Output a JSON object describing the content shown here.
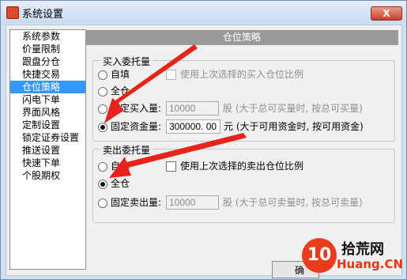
{
  "window": {
    "title": "系统设置",
    "close_label": "X"
  },
  "sidebar": {
    "items": [
      {
        "label": "系统参数"
      },
      {
        "label": "价量限制"
      },
      {
        "label": "跟盘分仓"
      },
      {
        "label": "快捷交易"
      },
      {
        "label": "仓位策略"
      },
      {
        "label": "闪电下单"
      },
      {
        "label": "界面风格"
      },
      {
        "label": "定制设置"
      },
      {
        "label": "锁定证券设置"
      },
      {
        "label": "推送设置"
      },
      {
        "label": "快速下单"
      },
      {
        "label": "个股期权"
      }
    ],
    "selected_index": 4
  },
  "panel": {
    "header": "仓位策略",
    "buy": {
      "legend": "买入委托量",
      "auto_label": "自填",
      "use_last_label": "使用上次选择的买入仓位比例",
      "full_label": "全仓",
      "fixed_qty_label": "固定买入量:",
      "fixed_qty_value": "10000",
      "fixed_qty_hint": "股 (大于总可买量时, 按总可买量)",
      "fixed_fund_label": "固定资金量:",
      "fixed_fund_value": "300000. 00",
      "fixed_fund_hint": "元 (大于可用资金时, 按可用资金)",
      "selected": "fixed_fund"
    },
    "sell": {
      "legend": "卖出委托量",
      "auto_label": "自填",
      "use_last_label": "使用上次选择的卖出仓位比例",
      "full_label": "全仓",
      "fixed_qty_label": "固定卖出量:",
      "fixed_qty_value": "10000",
      "fixed_qty_hint": "股 (大于总可卖量时, 按总可卖量)",
      "selected": "full"
    }
  },
  "footer": {
    "ok_partial": "确"
  },
  "watermark": {
    "logo_text": "10",
    "cn_text": "拾荒网",
    "url_text": "Huang.CN"
  },
  "colors": {
    "accent": "#3399ff",
    "arrow": "#e8241a",
    "header_bg": "#9a9a9a"
  }
}
